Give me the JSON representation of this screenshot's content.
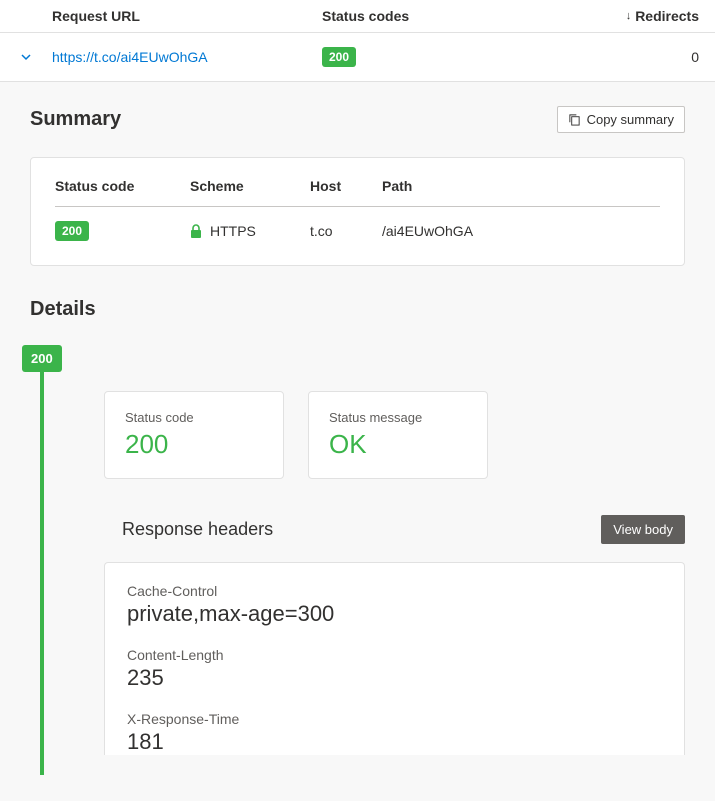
{
  "table": {
    "headers": {
      "url": "Request URL",
      "status": "Status codes",
      "redirects": "Redirects"
    },
    "row": {
      "url": "https://t.co/ai4EUwOhGA",
      "status_badge": "200",
      "redirects": "0"
    }
  },
  "summary": {
    "title": "Summary",
    "copy_button": "Copy summary",
    "headers": {
      "status": "Status code",
      "scheme": "Scheme",
      "host": "Host",
      "path": "Path"
    },
    "row": {
      "status_badge": "200",
      "scheme": "HTTPS",
      "host": "t.co",
      "path": "/ai4EUwOhGA"
    }
  },
  "details": {
    "title": "Details",
    "timeline_badge": "200",
    "status_code": {
      "label": "Status code",
      "value": "200"
    },
    "status_message": {
      "label": "Status message",
      "value": "OK"
    },
    "response_headers": {
      "title": "Response headers",
      "view_body_button": "View body",
      "items": [
        {
          "name": "Cache-Control",
          "value": "private,max-age=300"
        },
        {
          "name": "Content-Length",
          "value": "235"
        },
        {
          "name": "X-Response-Time",
          "value": "181"
        }
      ]
    }
  }
}
